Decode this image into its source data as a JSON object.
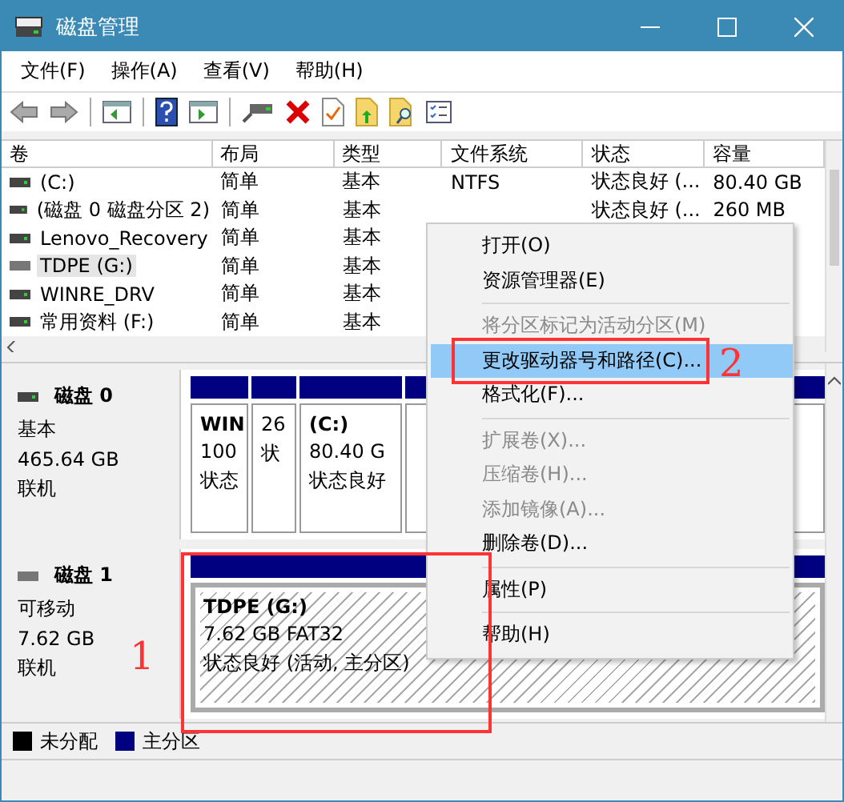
{
  "window": {
    "title": "磁盘管理"
  },
  "menu_bar": [
    "文件(F)",
    "操作(A)",
    "查看(V)",
    "帮助(H)"
  ],
  "toolbar": [
    {
      "kind": "back"
    },
    {
      "kind": "forward"
    },
    {
      "kind": "separator"
    },
    {
      "kind": "tree"
    },
    {
      "kind": "separator"
    },
    {
      "kind": "help"
    },
    {
      "kind": "pane"
    },
    {
      "kind": "separator"
    },
    {
      "kind": "drive"
    },
    {
      "kind": "delete"
    },
    {
      "kind": "check"
    },
    {
      "kind": "folder-up"
    },
    {
      "kind": "folder-search"
    },
    {
      "kind": "list"
    }
  ],
  "table": {
    "columns": [
      "卷",
      "布局",
      "类型",
      "文件系统",
      "状态",
      "容量"
    ],
    "rows": [
      {
        "cells": [
          "(C:)",
          "简单",
          "基本",
          "NTFS",
          "状态良好 (...",
          "80.40 GB"
        ],
        "selected": false,
        "removable": false
      },
      {
        "cells": [
          "(磁盘 0 磁盘分区 2)",
          "简单",
          "基本",
          "",
          "状态良好 (...",
          "260 MB"
        ],
        "selected": false,
        "removable": false
      },
      {
        "cells": [
          "Lenovo_Recovery",
          "简单",
          "基本"
        ],
        "selected": false,
        "removable": false
      },
      {
        "cells": [
          "TDPE (G:)",
          "简单",
          "基本"
        ],
        "selected": true,
        "removable": true
      },
      {
        "cells": [
          "WINRE_DRV",
          "简单",
          "基本"
        ],
        "selected": false,
        "removable": false
      },
      {
        "cells": [
          "常用资料 (F:)",
          "简单",
          "基本"
        ],
        "selected": false,
        "removable": false
      }
    ]
  },
  "disks": [
    {
      "name": "磁盘 0",
      "type": "基本",
      "size": "465.64 GB",
      "status": "联机",
      "removable": false,
      "partitions": [
        {
          "name": "WIN",
          "size": "100",
          "status": "状态",
          "selected": false
        },
        {
          "size": "26",
          "status": "状",
          "selected": false
        },
        {
          "name": "(C:)",
          "size": "80.40 G",
          "status": "状态良好",
          "selected": false
        }
      ]
    },
    {
      "name": "磁盘 1",
      "type": "可移动",
      "size": "7.62 GB",
      "status": "联机",
      "removable": true,
      "partitions": [
        {
          "name": "TDPE  (G:)",
          "size": "7.62 GB FAT32",
          "status": "状态良好 (活动, 主分区)",
          "selected": true
        }
      ]
    }
  ],
  "legend": [
    {
      "label": "未分配",
      "color": "#000000"
    },
    {
      "label": "主分区",
      "color": "#000080"
    }
  ],
  "context_menu": [
    {
      "kind": "item",
      "label": "打开(O)",
      "disabled": false,
      "selected": false
    },
    {
      "kind": "item",
      "label": "资源管理器(E)",
      "disabled": false,
      "selected": false
    },
    {
      "kind": "separator"
    },
    {
      "kind": "item",
      "label": "将分区标记为活动分区(M)",
      "disabled": true,
      "selected": false
    },
    {
      "kind": "item",
      "label": "更改驱动器号和路径(C)...",
      "disabled": false,
      "selected": true
    },
    {
      "kind": "item",
      "label": "格式化(F)...",
      "disabled": false,
      "selected": false
    },
    {
      "kind": "separator"
    },
    {
      "kind": "item",
      "label": "扩展卷(X)...",
      "disabled": true,
      "selected": false
    },
    {
      "kind": "item",
      "label": "压缩卷(H)...",
      "disabled": true,
      "selected": false
    },
    {
      "kind": "item",
      "label": "添加镜像(A)...",
      "disabled": true,
      "selected": false
    },
    {
      "kind": "item",
      "label": "删除卷(D)...",
      "disabled": false,
      "selected": false
    },
    {
      "kind": "separator"
    },
    {
      "kind": "item",
      "label": "属性(P)",
      "disabled": false,
      "selected": false
    },
    {
      "kind": "separator"
    },
    {
      "kind": "item",
      "label": "帮助(H)",
      "disabled": false,
      "selected": false
    }
  ],
  "annotations": [
    {
      "label": "1",
      "kind": "partition"
    },
    {
      "label": "2",
      "kind": "menu-item"
    }
  ]
}
